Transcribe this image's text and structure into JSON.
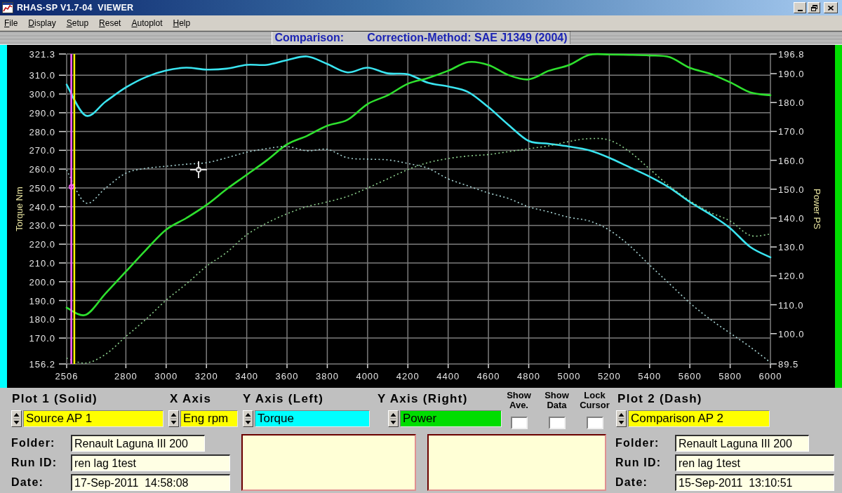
{
  "window": {
    "title": "RHAS-SP V1.7-04  VIEWER"
  },
  "menu": [
    "File",
    "Display",
    "Setup",
    "Reset",
    "Autoplot",
    "Help"
  ],
  "header": {
    "label": "Comparison:",
    "correction": "Correction-Method: SAE J1349 (2004)"
  },
  "chart": {
    "chart_data": {
      "type": "line",
      "grid": true,
      "xlim": [
        2506,
        6000
      ],
      "xticks": [
        2506,
        2800,
        3000,
        3200,
        3400,
        3600,
        3800,
        4000,
        4200,
        4400,
        4600,
        4800,
        5000,
        5200,
        5400,
        5600,
        5800,
        6000
      ],
      "ylabel": "Torque Nm",
      "ylim": [
        156.2,
        321.3
      ],
      "yticks": [
        {
          "value": 156.2,
          "label": "156.2"
        },
        {
          "value": 170,
          "label": "170.0"
        },
        {
          "value": 180,
          "label": "180.0"
        },
        {
          "value": 190,
          "label": "190.0"
        },
        {
          "value": 200,
          "label": "200.0"
        },
        {
          "value": 210,
          "label": "210.0"
        },
        {
          "value": 220,
          "label": "220.0"
        },
        {
          "value": 230,
          "label": "230.0"
        },
        {
          "value": 240,
          "label": "240.0"
        },
        {
          "value": 250,
          "label": "250.0"
        },
        {
          "value": 260,
          "label": "260.0"
        },
        {
          "value": 270,
          "label": "270.0"
        },
        {
          "value": 280,
          "label": "280.0"
        },
        {
          "value": 290,
          "label": "290.0"
        },
        {
          "value": 300,
          "label": "300.0"
        },
        {
          "value": 310,
          "label": "310.0"
        },
        {
          "value": 321.3,
          "label": "321.3"
        }
      ],
      "y2label": "Power PS",
      "y2lim": [
        89.5,
        196.8
      ],
      "y2ticks": [
        {
          "value": 89.5,
          "label": "89.5"
        },
        {
          "value": 100,
          "label": "100.0"
        },
        {
          "value": 110,
          "label": "110.0"
        },
        {
          "value": 120,
          "label": "120.0"
        },
        {
          "value": 130,
          "label": "130.0"
        },
        {
          "value": 140,
          "label": "140.0"
        },
        {
          "value": 150,
          "label": "150.0"
        },
        {
          "value": 160,
          "label": "160.0"
        },
        {
          "value": 170,
          "label": "170.0"
        },
        {
          "value": 180,
          "label": "180.0"
        },
        {
          "value": 190,
          "label": "190.0"
        },
        {
          "value": 196.8,
          "label": "196.8"
        }
      ],
      "x": [
        2506,
        2600,
        2700,
        2800,
        2900,
        3000,
        3100,
        3200,
        3300,
        3400,
        3500,
        3600,
        3700,
        3800,
        3900,
        4000,
        4100,
        4200,
        4300,
        4400,
        4500,
        4600,
        4700,
        4800,
        4900,
        5000,
        5100,
        5200,
        5300,
        5400,
        5500,
        5600,
        5700,
        5800,
        5900,
        6000
      ],
      "series": [
        {
          "color": "#3ae4f0",
          "values": [
            305,
            288.5,
            296,
            303.5,
            309,
            312.5,
            314,
            313,
            313.5,
            315.5,
            315.5,
            318,
            320,
            316,
            311.5,
            314,
            311,
            310.5,
            306,
            304,
            301,
            293,
            283.5,
            275,
            273.5,
            272,
            270,
            266,
            261,
            256,
            250,
            242.5,
            236,
            228.5,
            218.5,
            213
          ]
        },
        {
          "color": "#2ee02e",
          "axis": "y2",
          "values": [
            109,
            106.5,
            114,
            121.5,
            129,
            136,
            140,
            144.5,
            150,
            155,
            160,
            165.5,
            168.5,
            172,
            174,
            179.5,
            182.5,
            186.5,
            188.5,
            191,
            194,
            193,
            189.5,
            188,
            191,
            193,
            196.5,
            196.6,
            196.5,
            196.3,
            195.7,
            192,
            190,
            187,
            183.5,
            182.5
          ]
        },
        {
          "color": "#a8d4d4",
          "line_style": "dash",
          "values": [
            259.5,
            242,
            250,
            257.8,
            260.4,
            261.5,
            262.6,
            263.4,
            266,
            269,
            270.9,
            272,
            269.7,
            270.5,
            266,
            265.3,
            264.9,
            263,
            260.4,
            254.8,
            251,
            247.3,
            244.3,
            239.9,
            237.2,
            234.3,
            232.4,
            227.5,
            219.3,
            208.9,
            198.8,
            188.7,
            180.1,
            172.6,
            165.2,
            157
          ]
        },
        {
          "color": "#8ccf8c",
          "axis": "y2",
          "line_style": "dash",
          "values": [
            91.5,
            89.8,
            92.9,
            99,
            105,
            111.6,
            117.2,
            123.3,
            128.1,
            134.2,
            138.3,
            141.5,
            144,
            145.6,
            147.5,
            150.4,
            153.6,
            156.8,
            159.2,
            160.6,
            161.5,
            162,
            163,
            164,
            165,
            166.5,
            167.5,
            167,
            163,
            157,
            151,
            146,
            142,
            139,
            134,
            134.5
          ]
        }
      ],
      "ref_lines": [
        {
          "axis": "x",
          "value": 2529,
          "color": "#ff66ff"
        },
        {
          "axis": "x",
          "value": 2544,
          "color": "#ffff00"
        }
      ]
    }
  },
  "selectors": [
    {
      "heading": "Plot 1 (Solid)",
      "value": "Source AP 1",
      "color": "#ffff00"
    },
    {
      "heading": "X Axis",
      "value": "Eng rpm",
      "color": "#ffff00"
    },
    {
      "heading": "Y Axis (Left)",
      "value": "Torque",
      "color": "#00ffff"
    },
    {
      "heading": "Y Axis (Right)",
      "value": "Power",
      "color": "#00dd00"
    }
  ],
  "options": [
    {
      "label": "Show Ave.",
      "checked": false
    },
    {
      "label": "Show Data",
      "checked": false
    },
    {
      "label": "Lock Cursor",
      "checked": false
    }
  ],
  "plot_2": {
    "heading": "Plot 2 (Dash)",
    "value": "Comparison AP 2",
    "color": "#ffff00"
  },
  "runs": [
    {
      "fields": [
        {
          "label": "Folder:",
          "value": "Renault Laguna III 200"
        },
        {
          "label": "Run ID:",
          "value": "ren lag 1test"
        },
        {
          "label": "Date:",
          "value": "17-Sep-2011  14:58:08"
        }
      ]
    },
    {
      "fields": [
        {
          "label": "Folder:",
          "value": "Renault Laguna III 200"
        },
        {
          "label": "Run ID:",
          "value": "ren lag 1test"
        },
        {
          "label": "Date:",
          "value": "15-Sep-2011  13:10:51"
        }
      ]
    }
  ]
}
